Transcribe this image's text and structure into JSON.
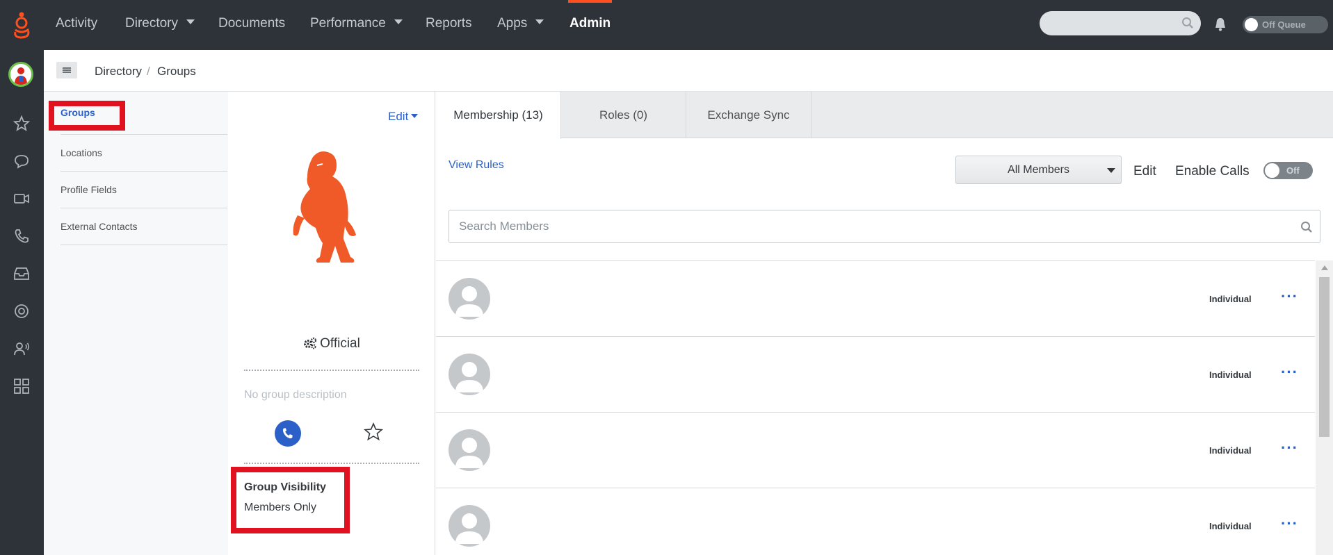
{
  "nav": {
    "items": [
      {
        "label": "Activity",
        "caret": false,
        "active": false
      },
      {
        "label": "Directory",
        "caret": true,
        "active": false
      },
      {
        "label": "Documents",
        "caret": false,
        "active": false
      },
      {
        "label": "Performance",
        "caret": true,
        "active": false
      },
      {
        "label": "Reports",
        "caret": false,
        "active": false
      },
      {
        "label": "Apps",
        "caret": true,
        "active": false
      },
      {
        "label": "Admin",
        "caret": false,
        "active": true
      }
    ],
    "search_placeholder": "",
    "queue_toggle_label": "Off Queue"
  },
  "rail": {
    "icons": [
      "favorites-star-icon",
      "chat-icon",
      "video-icon",
      "phone-icon",
      "inbox-icon",
      "help-lifebuoy-icon",
      "contacts-icon",
      "apps-grid-icon"
    ]
  },
  "breadcrumb": {
    "items": [
      "Directory",
      "Groups"
    ],
    "separator": "/"
  },
  "subnav": {
    "items": [
      "Groups",
      "Locations",
      "Profile Fields",
      "External Contacts"
    ],
    "active": "Groups"
  },
  "profile": {
    "edit_label": "Edit",
    "type_label": "Official",
    "description": "No group description",
    "visibility_title": "Group Visibility",
    "visibility_value": "Members Only"
  },
  "tabs": [
    {
      "label": "Membership (13)",
      "active": true
    },
    {
      "label": "Roles (0)",
      "active": false
    },
    {
      "label": "Exchange Sync",
      "active": false
    }
  ],
  "membership": {
    "view_rules_label": "View Rules",
    "filter_selected": "All Members",
    "edit_label": "Edit",
    "enable_calls_label": "Enable Calls",
    "calls_toggle_label": "Off",
    "search_placeholder": "Search Members",
    "members": [
      {
        "type": "Individual",
        "more": "···"
      },
      {
        "type": "Individual",
        "more": "···"
      },
      {
        "type": "Individual",
        "more": "···"
      },
      {
        "type": "Individual",
        "more": "···"
      }
    ]
  },
  "colors": {
    "nav_bg": "#2d3338",
    "accent_orange": "#ff4f1f",
    "link_blue": "#2a60c8",
    "highlight_red": "#e0121f"
  }
}
